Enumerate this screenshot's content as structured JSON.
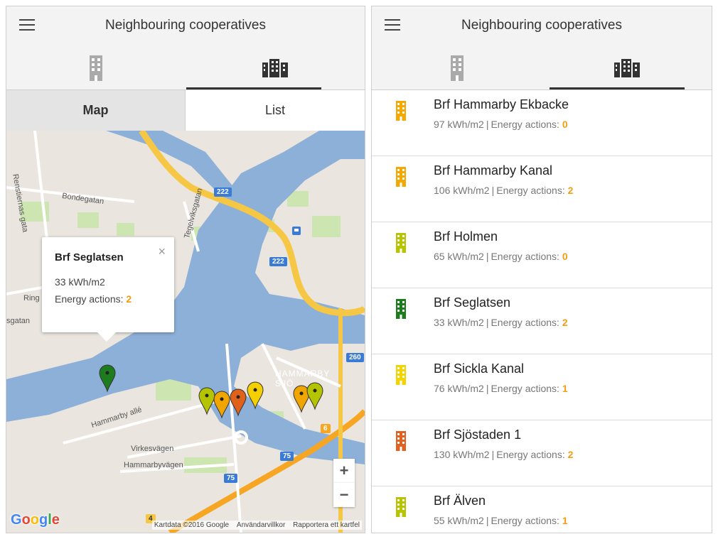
{
  "header": {
    "title": "Neighbouring cooperatives"
  },
  "segment": {
    "map_label": "Map",
    "list_label": "List"
  },
  "popup": {
    "title": "Brf Seglatsen",
    "energy_use": "33 kWh/m2",
    "actions_label": "Energy actions:",
    "actions_value": "2",
    "close_label": "×"
  },
  "map": {
    "street_labels": {
      "bondegatan": "Bondegatan",
      "rensternas": "Renstiernas gata",
      "tegelviksgatan": "Tegelviksgatan",
      "hammarby_alle": "Hammarby allé",
      "virkesvagen": "Virkesvägen",
      "hammarbyvagen": "Hammarbyvägen",
      "ringvagen": "Ring",
      "sgatan": "sgatan",
      "hammarby_sjostad": "HAMMARBY SJÖ"
    },
    "route_badges": {
      "r222a": "222",
      "r222b": "222",
      "r260": "260",
      "r6": "6",
      "r75a": "75",
      "r75b": "75",
      "r4": "4"
    },
    "zoom_in": "+",
    "zoom_out": "−",
    "google": {
      "G": "G",
      "o1": "o",
      "o2": "o",
      "g": "g",
      "l": "l",
      "e": "e"
    },
    "attribution": {
      "data": "Kartdata ©2016 Google",
      "terms": "Användarvillkor",
      "report": "Rapportera ett kartfel"
    },
    "markers": [
      {
        "color": "#1e7b1e",
        "label": "Brf Seglatsen"
      },
      {
        "color": "#b5c400"
      },
      {
        "color": "#f0a500"
      },
      {
        "color": "#e0621a"
      },
      {
        "color": "#f5d000"
      },
      {
        "color": "#f0a500"
      },
      {
        "color": "#b5c400"
      }
    ]
  },
  "list": {
    "actions_label": "Energy actions:",
    "items": [
      {
        "name": "Brf Hammarby Ekbacke",
        "kwh": "97 kWh/m2",
        "actions": "0",
        "color": "#f5a800"
      },
      {
        "name": "Brf Hammarby Kanal",
        "kwh": "106 kWh/m2",
        "actions": "2",
        "color": "#f5a800"
      },
      {
        "name": "Brf Holmen",
        "kwh": "65 kWh/m2",
        "actions": "0",
        "color": "#b8c400"
      },
      {
        "name": "Brf Seglatsen",
        "kwh": "33 kWh/m2",
        "actions": "2",
        "color": "#1c7d1c"
      },
      {
        "name": "Brf Sickla Kanal",
        "kwh": "76 kWh/m2",
        "actions": "1",
        "color": "#f2d400"
      },
      {
        "name": "Brf Sjöstaden 1",
        "kwh": "130 kWh/m2",
        "actions": "2",
        "color": "#e06120"
      },
      {
        "name": "Brf Älven",
        "kwh": "55 kWh/m2",
        "actions": "1",
        "color": "#b8c400"
      }
    ]
  },
  "colors": {
    "accent": "#f39c12",
    "building_inactive": "#aaaaaa",
    "building_active": "#333333",
    "water": "#8db0d8",
    "park": "#cde5b0",
    "highway": "#f6c744"
  }
}
